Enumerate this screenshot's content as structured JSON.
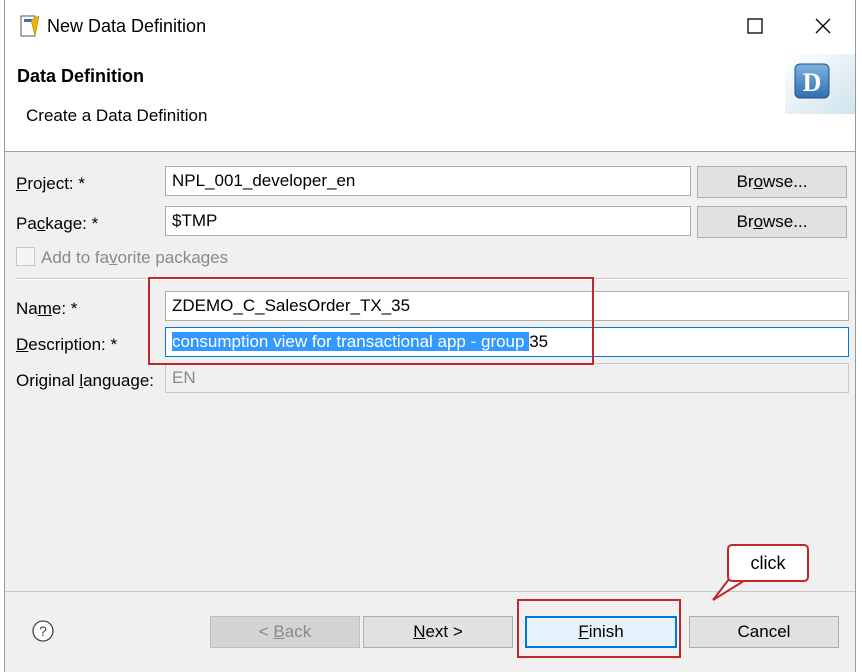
{
  "window": {
    "title": "New Data Definition"
  },
  "header": {
    "title": "Data Definition",
    "subtitle": "Create a Data Definition",
    "badge_letter": "D"
  },
  "form": {
    "project": {
      "label_pre": "",
      "label_mn": "P",
      "label_post": "roject: *",
      "value": "NPL_001_developer_en"
    },
    "package": {
      "label_pre": "Pa",
      "label_mn": "c",
      "label_post": "kage: *",
      "value": "$TMP"
    },
    "browse_project": {
      "pre": "Br",
      "mn": "o",
      "post": "wse..."
    },
    "browse_package": {
      "pre": "Br",
      "mn": "o",
      "post": "wse..."
    },
    "favorite": {
      "pre": "Add to fa",
      "mn": "v",
      "post": "orite packages",
      "checked": false
    },
    "name": {
      "label_pre": "Na",
      "label_mn": "m",
      "label_post": "e: *",
      "value": "ZDEMO_C_SalesOrder_TX_35"
    },
    "description": {
      "label_pre": "",
      "label_mn": "D",
      "label_post": "escription: *",
      "value_selected": "consumption view for transactional app - group ",
      "value_rest": "35"
    },
    "language": {
      "label_pre": "Original ",
      "label_mn": "l",
      "label_post": "anguage:",
      "value": "EN"
    }
  },
  "buttons": {
    "back": {
      "pre": "< ",
      "mn": "B",
      "post": "ack"
    },
    "next": {
      "pre": "",
      "mn": "N",
      "post": "ext >"
    },
    "finish": {
      "pre": "",
      "mn": "F",
      "post": "inish"
    },
    "cancel": "Cancel"
  },
  "annotation": {
    "callout_text": "click",
    "color": "#c0272d"
  },
  "colors": {
    "selection": "#3399ff",
    "focus": "#0078d7"
  }
}
